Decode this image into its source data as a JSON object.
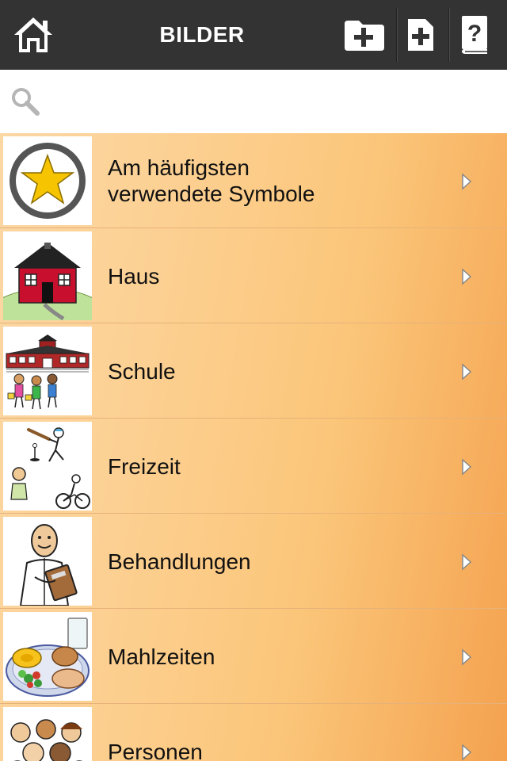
{
  "header": {
    "title": "BILDER",
    "home_icon": "home-icon",
    "add_folder_icon": "folder-plus-icon",
    "add_item_icon": "document-plus-icon",
    "help_icon": "help-book-icon",
    "background": "#333333"
  },
  "search": {
    "placeholder": "",
    "value": "",
    "icon": "search-icon"
  },
  "list": {
    "gradient_start": "#fbd7a4",
    "gradient_end": "#f4a24f",
    "items": [
      {
        "label": "Am häufigsten verwendete Symbole",
        "icon": "star-icon"
      },
      {
        "label": "Haus",
        "icon": "house-icon"
      },
      {
        "label": "Schule",
        "icon": "school-icon"
      },
      {
        "label": "Freizeit",
        "icon": "leisure-icon"
      },
      {
        "label": "Behandlungen",
        "icon": "treatment-icon"
      },
      {
        "label": "Mahlzeiten",
        "icon": "meal-icon"
      },
      {
        "label": "Personen",
        "icon": "people-icon"
      }
    ]
  }
}
